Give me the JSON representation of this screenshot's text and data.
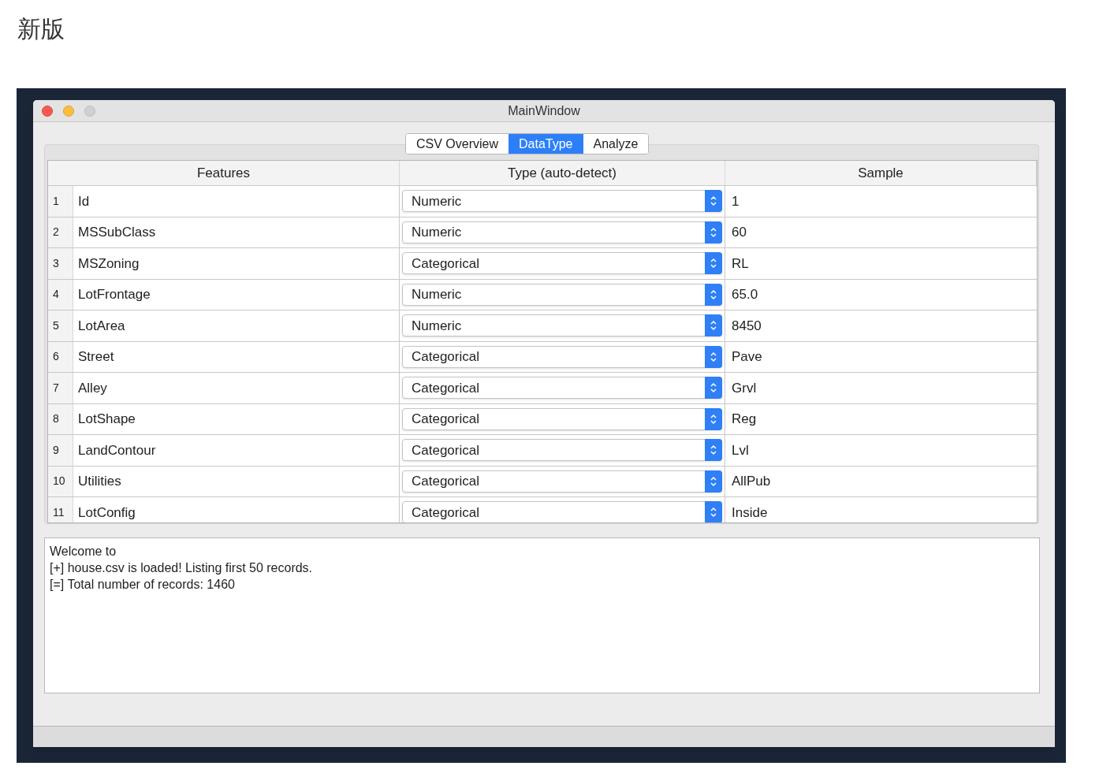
{
  "heading": "新版",
  "window": {
    "title": "MainWindow"
  },
  "tabs": [
    {
      "label": "CSV Overview",
      "selected": false
    },
    {
      "label": "DataType",
      "selected": true
    },
    {
      "label": "Analyze",
      "selected": false
    }
  ],
  "table": {
    "columns": [
      "Features",
      "Type (auto-detect)",
      "Sample"
    ],
    "rows": [
      {
        "index": "1",
        "feature": "Id",
        "type": "Numeric",
        "sample": "1"
      },
      {
        "index": "2",
        "feature": "MSSubClass",
        "type": "Numeric",
        "sample": "60"
      },
      {
        "index": "3",
        "feature": "MSZoning",
        "type": "Categorical",
        "sample": "RL"
      },
      {
        "index": "4",
        "feature": "LotFrontage",
        "type": "Numeric",
        "sample": "65.0"
      },
      {
        "index": "5",
        "feature": "LotArea",
        "type": "Numeric",
        "sample": "8450"
      },
      {
        "index": "6",
        "feature": "Street",
        "type": "Categorical",
        "sample": "Pave"
      },
      {
        "index": "7",
        "feature": "Alley",
        "type": "Categorical",
        "sample": "Grvl"
      },
      {
        "index": "8",
        "feature": "LotShape",
        "type": "Categorical",
        "sample": "Reg"
      },
      {
        "index": "9",
        "feature": "LandContour",
        "type": "Categorical",
        "sample": "Lvl"
      },
      {
        "index": "10",
        "feature": "Utilities",
        "type": "Categorical",
        "sample": "AllPub"
      },
      {
        "index": "11",
        "feature": "LotConfig",
        "type": "Categorical",
        "sample": "Inside"
      }
    ]
  },
  "log": [
    "Welcome to",
    "[+] house.csv is loaded! Listing first 50 records.",
    "[=] Total number of records: 1460"
  ]
}
